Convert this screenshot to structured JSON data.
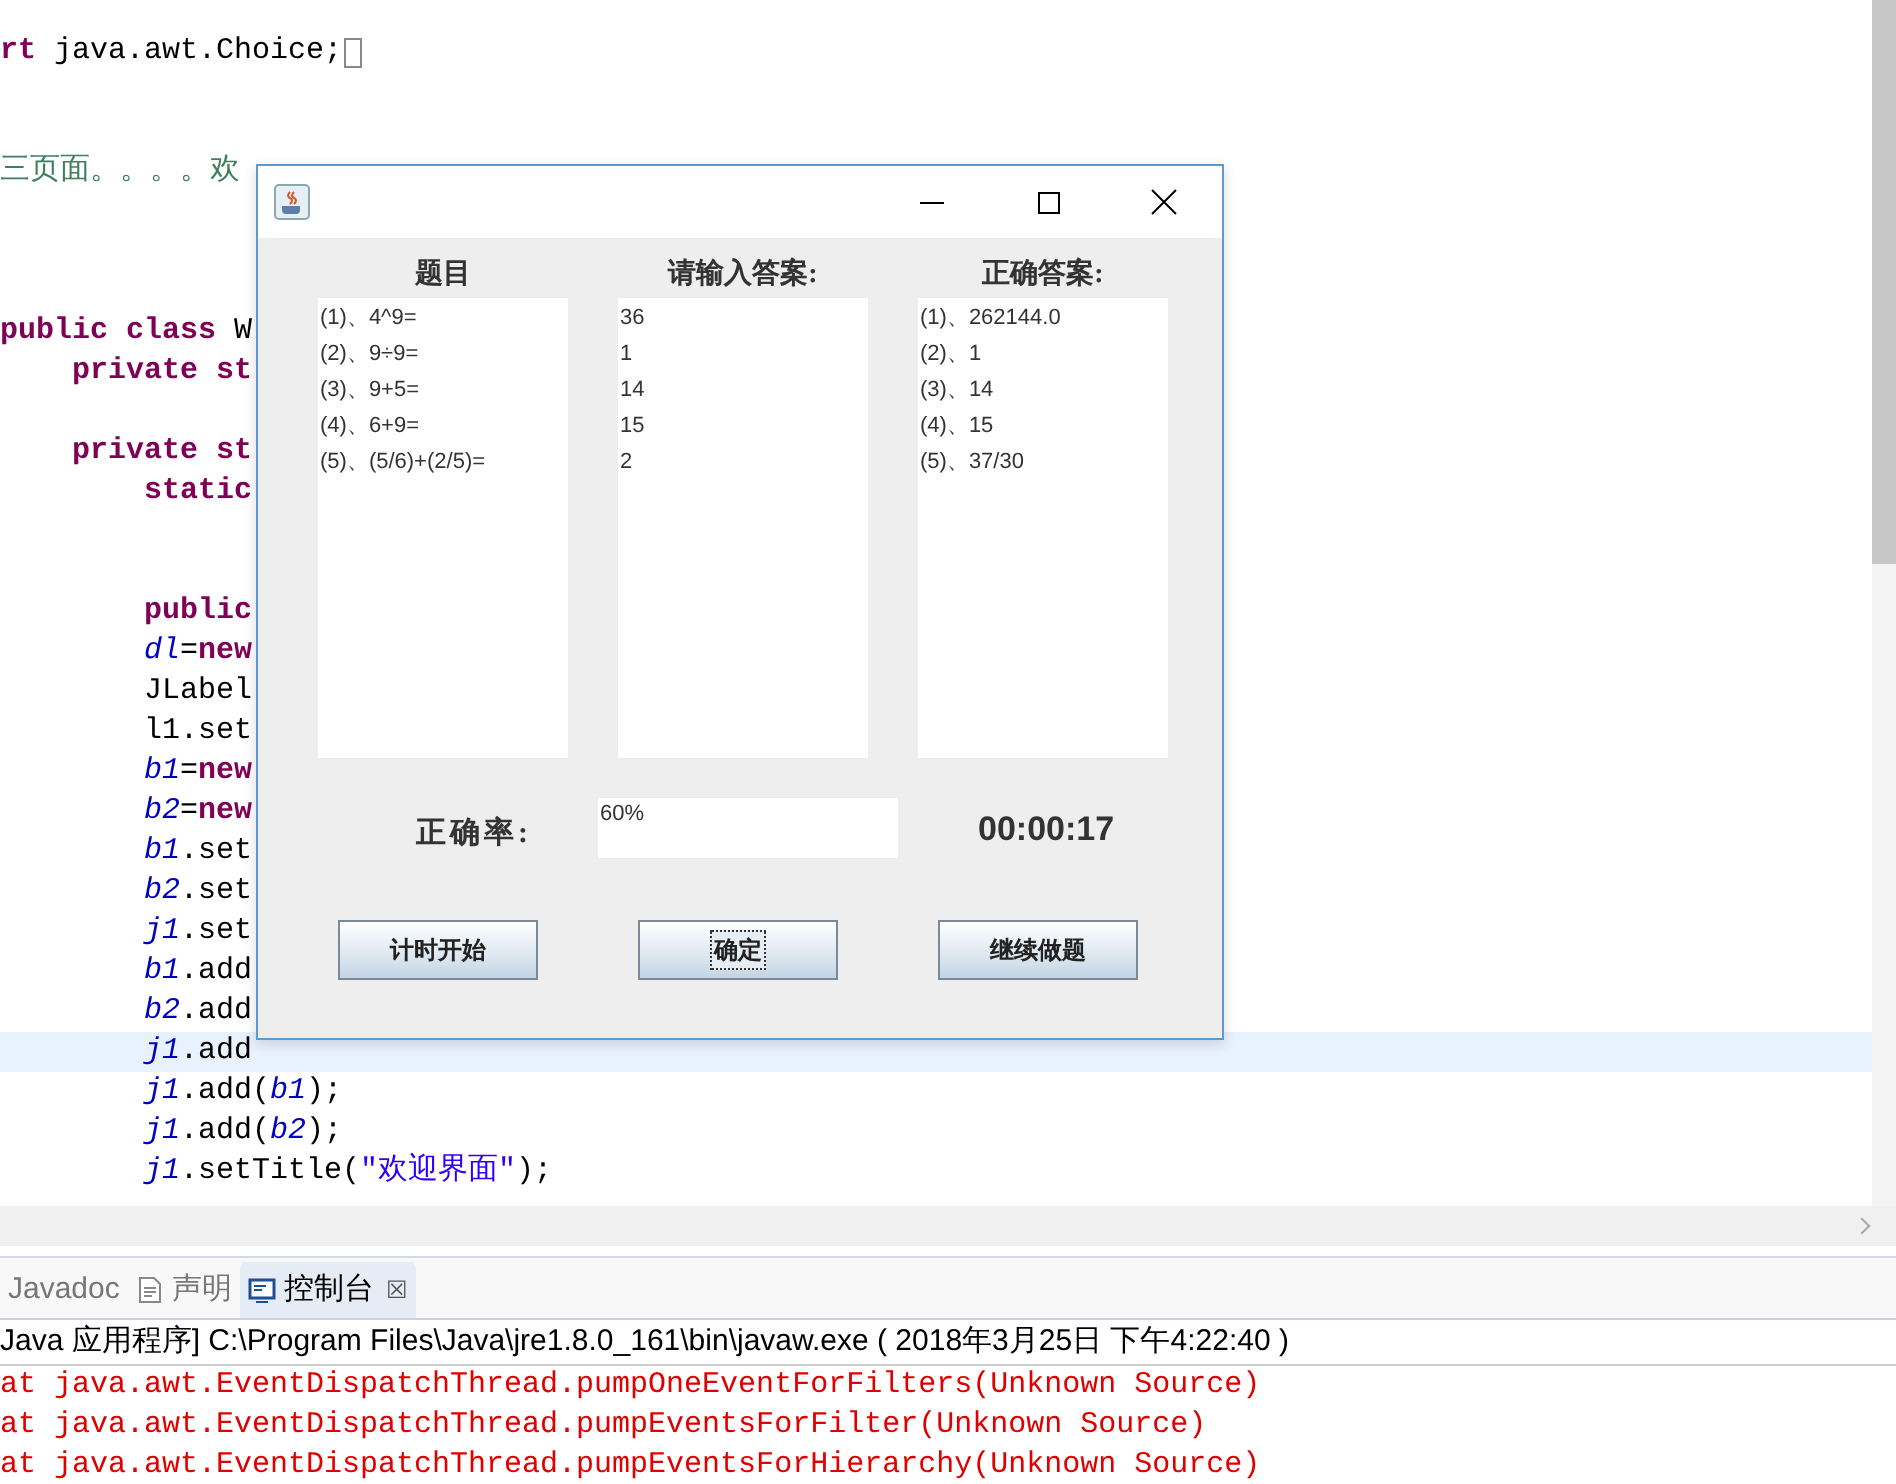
{
  "editor": {
    "lines": [
      {
        "kind": "code",
        "segments": [
          {
            "kind": "keyword",
            "text": "rt"
          },
          {
            "kind": "plain",
            "text": " java.awt.Choice;"
          }
        ],
        "marker": true
      },
      {
        "kind": "blank"
      },
      {
        "kind": "blank"
      },
      {
        "kind": "code",
        "segments": [
          {
            "kind": "comment",
            "text": "三页面。。。。欢"
          }
        ]
      },
      {
        "kind": "blank"
      },
      {
        "kind": "blank"
      },
      {
        "kind": "blank"
      },
      {
        "kind": "code",
        "segments": [
          {
            "kind": "keyword",
            "text": "public class"
          },
          {
            "kind": "plain",
            "text": " W"
          }
        ],
        "children": [
          {
            "kind": "code",
            "segments": [
              {
                "kind": "keyword",
                "text": "private st"
              }
            ]
          },
          {
            "kind": "blank"
          },
          {
            "kind": "code",
            "segments": [
              {
                "kind": "keyword",
                "text": "private st"
              }
            ],
            "children": [
              {
                "kind": "code",
                "segments": [
                  {
                    "kind": "keyword",
                    "text": "static"
                  }
                ]
              },
              {
                "kind": "blank"
              },
              {
                "kind": "blank"
              },
              {
                "kind": "code",
                "segments": [
                  {
                    "kind": "keyword",
                    "text": "public"
                  }
                ]
              },
              {
                "kind": "code",
                "segments": [
                  {
                    "kind": "field",
                    "text": "dl"
                  },
                  {
                    "kind": "plain",
                    "text": "="
                  },
                  {
                    "kind": "keyword",
                    "text": "new"
                  }
                ]
              },
              {
                "kind": "code",
                "segments": [
                  {
                    "kind": "plain",
                    "text": "JLabel"
                  }
                ]
              },
              {
                "kind": "code",
                "segments": [
                  {
                    "kind": "plain",
                    "text": "l1.set"
                  }
                ]
              },
              {
                "kind": "code",
                "segments": [
                  {
                    "kind": "field",
                    "text": "b1"
                  },
                  {
                    "kind": "plain",
                    "text": "="
                  },
                  {
                    "kind": "keyword",
                    "text": "new"
                  }
                ]
              },
              {
                "kind": "code",
                "segments": [
                  {
                    "kind": "field",
                    "text": "b2"
                  },
                  {
                    "kind": "plain",
                    "text": "="
                  },
                  {
                    "kind": "keyword",
                    "text": "new"
                  }
                ]
              },
              {
                "kind": "code",
                "segments": [
                  {
                    "kind": "field",
                    "text": "b1"
                  },
                  {
                    "kind": "plain",
                    "text": ".set"
                  }
                ]
              },
              {
                "kind": "code",
                "segments": [
                  {
                    "kind": "field",
                    "text": "b2"
                  },
                  {
                    "kind": "plain",
                    "text": ".set"
                  }
                ]
              },
              {
                "kind": "code",
                "segments": [
                  {
                    "kind": "field",
                    "text": "j1"
                  },
                  {
                    "kind": "plain",
                    "text": ".set"
                  }
                ]
              },
              {
                "kind": "code",
                "segments": [
                  {
                    "kind": "field",
                    "text": "b1"
                  },
                  {
                    "kind": "plain",
                    "text": ".add"
                  }
                ]
              },
              {
                "kind": "code",
                "segments": [
                  {
                    "kind": "field",
                    "text": "b2"
                  },
                  {
                    "kind": "plain",
                    "text": ".add"
                  }
                ]
              },
              {
                "kind": "code",
                "current": true,
                "segments": [
                  {
                    "kind": "field",
                    "text": "j1"
                  },
                  {
                    "kind": "plain",
                    "text": ".add"
                  }
                ]
              },
              {
                "kind": "code",
                "segments": [
                  {
                    "kind": "field",
                    "text": "j1"
                  },
                  {
                    "kind": "plain",
                    "text": ".add("
                  },
                  {
                    "kind": "field",
                    "text": "b1"
                  },
                  {
                    "kind": "plain",
                    "text": ");"
                  }
                ]
              },
              {
                "kind": "code",
                "segments": [
                  {
                    "kind": "field",
                    "text": "j1"
                  },
                  {
                    "kind": "plain",
                    "text": ".add("
                  },
                  {
                    "kind": "field",
                    "text": "b2"
                  },
                  {
                    "kind": "plain",
                    "text": ");"
                  }
                ]
              },
              {
                "kind": "code",
                "segments": [
                  {
                    "kind": "field",
                    "text": "j1"
                  },
                  {
                    "kind": "plain",
                    "text": ".setTitle("
                  },
                  {
                    "kind": "string",
                    "text": "\"欢迎界面\""
                  },
                  {
                    "kind": "plain",
                    "text": ");"
                  }
                ]
              }
            ]
          }
        ]
      }
    ]
  },
  "dialog": {
    "columns": [
      {
        "heading": "题目",
        "items": [
          "(1)、4^9=",
          "(2)、9÷9=",
          "(3)、9+5=",
          "(4)、6+9=",
          "(5)、(5/6)+(2/5)="
        ]
      },
      {
        "heading": "请输入答案:",
        "items": [
          "36",
          "1",
          "14",
          "15",
          "2"
        ]
      },
      {
        "heading": "正确答案:",
        "items": [
          "(1)、262144.0",
          "(2)、1",
          "(3)、14",
          "(4)、15",
          "(5)、37/30"
        ]
      }
    ],
    "accuracy_label": "正确率:",
    "accuracy_value": "60%",
    "timer": "00:00:17",
    "buttons": [
      {
        "label": "计时开始",
        "focused": false
      },
      {
        "label": "确定",
        "focused": true
      },
      {
        "label": "继续做题",
        "focused": false
      }
    ]
  },
  "bottom_tabs": [
    {
      "label": "Javadoc",
      "selected": false,
      "closable": false
    },
    {
      "label": "声明",
      "selected": false,
      "closable": false
    },
    {
      "label": "控制台",
      "selected": true,
      "closable": true,
      "close": "☒"
    }
  ],
  "console": {
    "header": "Java 应用程序] C:\\Program Files\\Java\\jre1.8.0_161\\bin\\javaw.exe ( 2018年3月25日 下午4:22:40 )",
    "lines": [
      "at java.awt.EventDispatchThread.pumpOneEventForFilters(Unknown Source)",
      "at java.awt.EventDispatchThread.pumpEventsForFilter(Unknown Source)",
      "at java.awt.EventDispatchThread.pumpEventsForHierarchy(Unknown Source)"
    ]
  }
}
